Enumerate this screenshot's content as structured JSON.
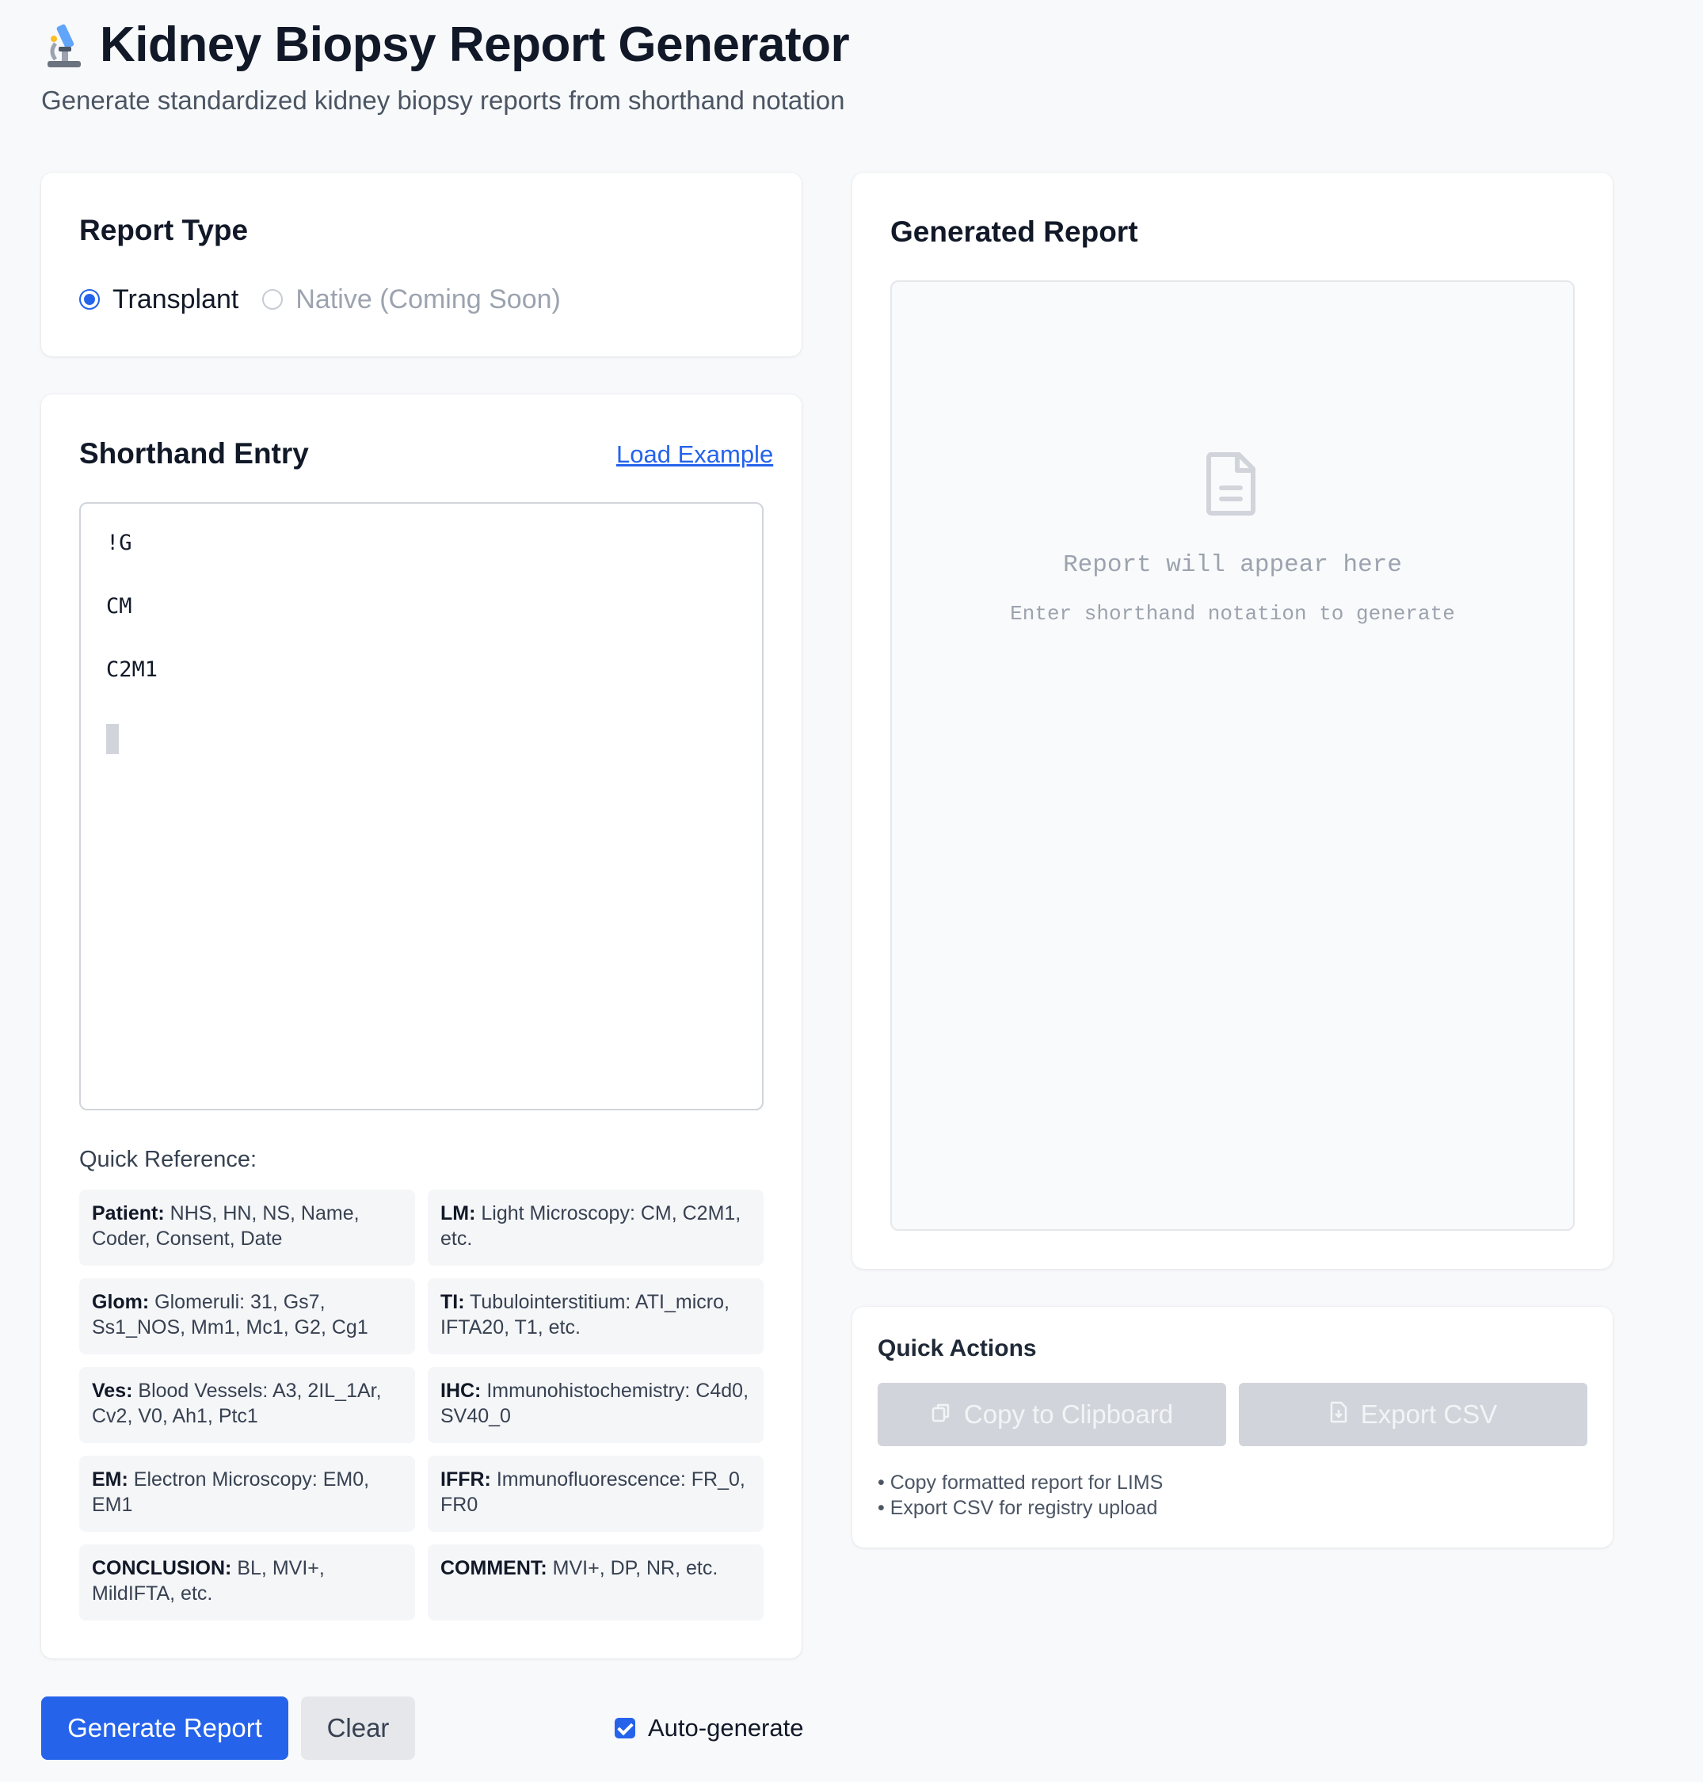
{
  "header": {
    "icon": "microscope-icon",
    "title": "Kidney Biopsy Report Generator",
    "subtitle": "Generate standardized kidney biopsy reports from shorthand notation"
  },
  "report_type": {
    "title": "Report Type",
    "options": [
      {
        "label": "Transplant",
        "selected": true,
        "disabled": false
      },
      {
        "label": "Native (Coming Soon)",
        "selected": false,
        "disabled": true
      }
    ]
  },
  "shorthand": {
    "title": "Shorthand Entry",
    "load_example": "Load Example",
    "lines": [
      "!G",
      "CM",
      "C2M1"
    ]
  },
  "quick_reference": {
    "label": "Quick Reference:",
    "items": [
      {
        "key": "Patient:",
        "text": "NHS, HN, NS, Name, Coder, Consent, Date"
      },
      {
        "key": "LM:",
        "text": "Light Microscopy: CM, C2M1, etc."
      },
      {
        "key": "Glom:",
        "text": "Glomeruli: 31, Gs7, Ss1_NOS, Mm1, Mc1, G2, Cg1"
      },
      {
        "key": "TI:",
        "text": "Tubulointerstitium: ATI_micro, IFTA20, T1, etc."
      },
      {
        "key": "Ves:",
        "text": "Blood Vessels: A3, 2IL_1Ar, Cv2, V0, Ah1, Ptc1"
      },
      {
        "key": "IHC:",
        "text": "Immunohistochemistry: C4d0, SV40_0"
      },
      {
        "key": "EM:",
        "text": "Electron Microscopy: EM0, EM1"
      },
      {
        "key": "IFFR:",
        "text": "Immunofluorescence: FR_0, FR0"
      },
      {
        "key": "CONCLUSION:",
        "text": "BL, MVI+, MildIFTA, etc."
      },
      {
        "key": "COMMENT:",
        "text": "MVI+, DP, NR, etc."
      }
    ]
  },
  "actions": {
    "generate": "Generate Report",
    "clear": "Clear",
    "auto_generate": "Auto-generate",
    "auto_generate_checked": true
  },
  "report": {
    "title": "Generated Report",
    "empty_icon": "document-icon",
    "empty_title": "Report will appear here",
    "empty_hint": "Enter shorthand notation to generate"
  },
  "quick_actions": {
    "title": "Quick Actions",
    "copy_label": "Copy to Clipboard",
    "export_label": "Export CSV",
    "notes": [
      "• Copy formatted report for LIMS",
      "• Export CSV for registry upload"
    ]
  },
  "colors": {
    "accent": "#2563eb",
    "background": "#f8f9fb",
    "disabled_button": "#d1d5db"
  }
}
